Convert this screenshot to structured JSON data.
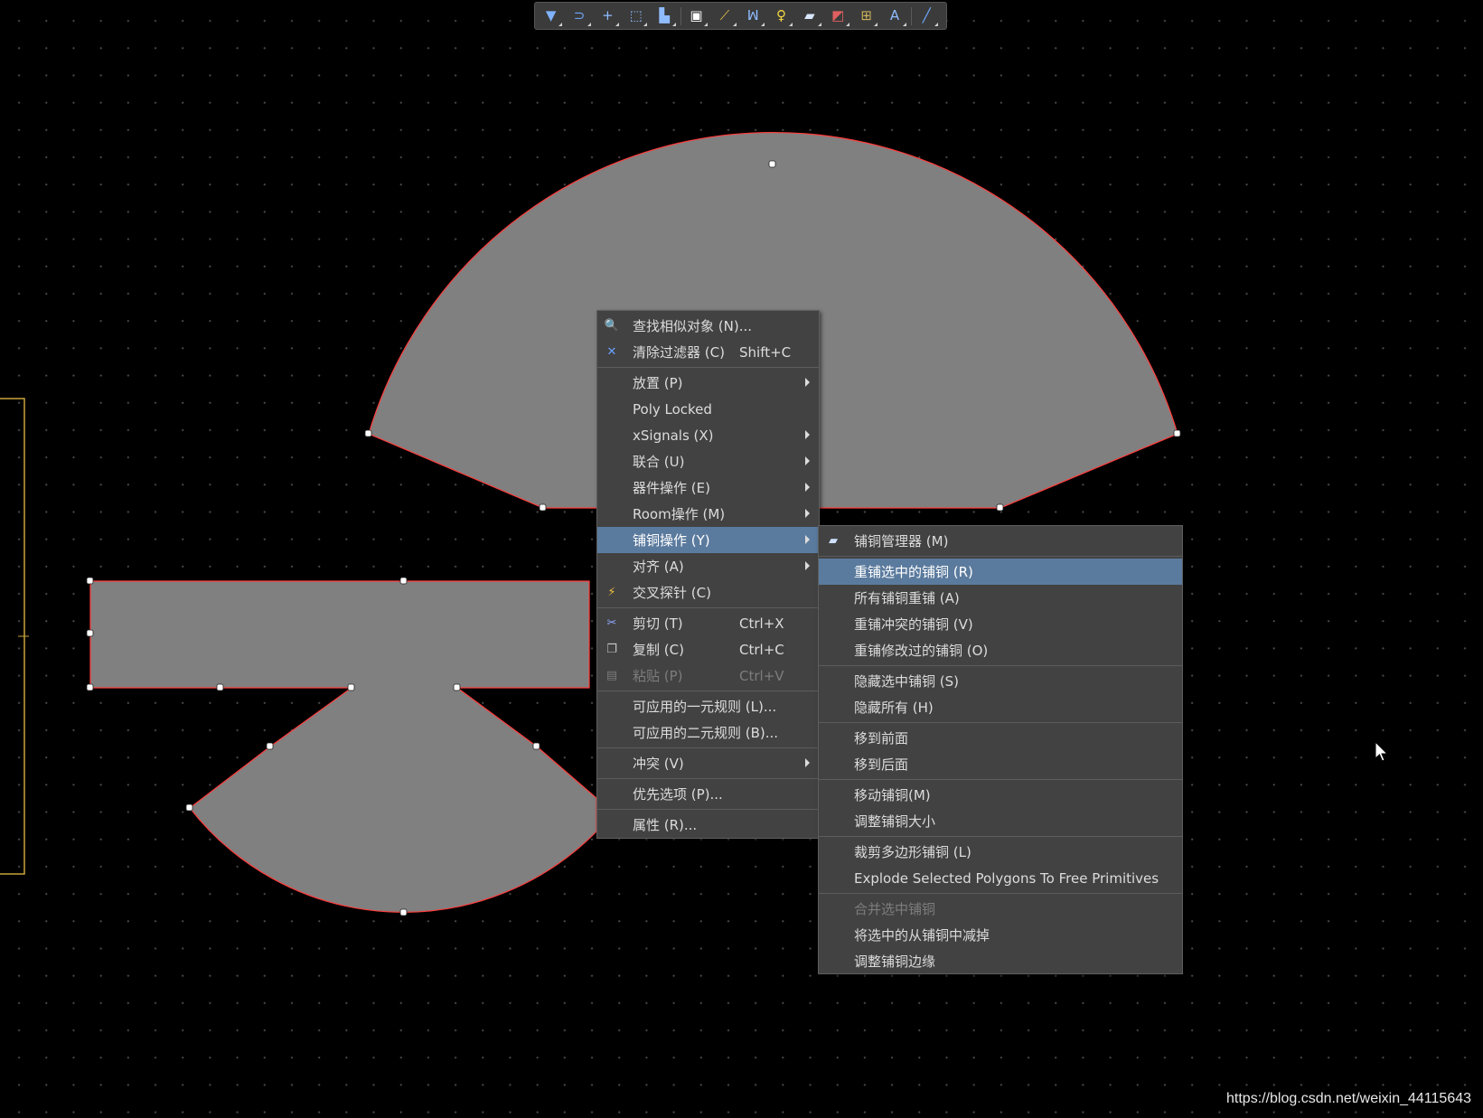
{
  "toolbar": {
    "tools": [
      {
        "name": "filter-icon",
        "glyph": "▼",
        "color": "#7fb2ff"
      },
      {
        "name": "route-icon",
        "glyph": "⊃",
        "color": "#6fa8ff"
      },
      {
        "name": "crosshair-icon",
        "glyph": "+",
        "color": "#8fbcff"
      },
      {
        "name": "select-rect-icon",
        "glyph": "⬚",
        "color": "#8fbcff"
      },
      {
        "name": "align-icon",
        "glyph": "▙",
        "color": "#8fbcff"
      },
      {
        "name": "component-icon",
        "glyph": "▣",
        "color": "#ffffff"
      },
      {
        "name": "interactive-route-icon",
        "glyph": "⟋",
        "color": "#e8c04a"
      },
      {
        "name": "diff-pair-icon",
        "glyph": "ꟽ",
        "color": "#8fbcff"
      },
      {
        "name": "via-icon",
        "glyph": "♀",
        "color": "#f5d742"
      },
      {
        "name": "polygon-icon",
        "glyph": "▰",
        "color": "#d8e6ff"
      },
      {
        "name": "keepout-icon",
        "glyph": "◩",
        "color": "#e06060"
      },
      {
        "name": "dimension-icon",
        "glyph": "⊞",
        "color": "#cbb25a"
      },
      {
        "name": "text-icon",
        "glyph": "A",
        "color": "#8fbcff"
      },
      {
        "name": "line-icon",
        "glyph": "╱",
        "color": "#6fa8ff"
      }
    ]
  },
  "main_menu": {
    "items": [
      {
        "type": "item",
        "label": "查找相似对象 (N)...",
        "icon": "find-similar-icon",
        "glyph": "🔍",
        "icon_color": "#e0e0e0"
      },
      {
        "type": "item",
        "label": "清除过滤器 (C)",
        "shortcut": "Shift+C",
        "icon": "clear-filter-icon",
        "glyph": "✕",
        "icon_color": "#6aa0ff"
      },
      {
        "type": "sep"
      },
      {
        "type": "item",
        "label": "放置 (P)",
        "submenu": true
      },
      {
        "type": "item",
        "label": "Poly Locked"
      },
      {
        "type": "item",
        "label": "xSignals (X)",
        "submenu": true
      },
      {
        "type": "item",
        "label": "联合 (U)",
        "submenu": true
      },
      {
        "type": "item",
        "label": "器件操作 (E)",
        "submenu": true
      },
      {
        "type": "item",
        "label": "Room操作 (M)",
        "submenu": true
      },
      {
        "type": "item",
        "label": "铺铜操作 (Y)",
        "submenu": true,
        "highlighted": true
      },
      {
        "type": "item",
        "label": "对齐 (A)",
        "submenu": true
      },
      {
        "type": "item",
        "label": "交叉探针 (C)",
        "icon": "cross-probe-icon",
        "glyph": "⚡",
        "icon_color": "#f0c040"
      },
      {
        "type": "sep"
      },
      {
        "type": "item",
        "label": "剪切 (T)",
        "shortcut": "Ctrl+X",
        "icon": "cut-icon",
        "glyph": "✂",
        "icon_color": "#8fa8ff"
      },
      {
        "type": "item",
        "label": "复制 (C)",
        "shortcut": "Ctrl+C",
        "icon": "copy-icon",
        "glyph": "❐",
        "icon_color": "#c8c8c8"
      },
      {
        "type": "item",
        "label": "粘贴 (P)",
        "shortcut": "Ctrl+V",
        "icon": "paste-icon",
        "glyph": "▤",
        "icon_color": "#7a7a7a",
        "disabled": true
      },
      {
        "type": "sep"
      },
      {
        "type": "item",
        "label": "可应用的一元规则 (L)..."
      },
      {
        "type": "item",
        "label": "可应用的二元规则 (B)..."
      },
      {
        "type": "sep"
      },
      {
        "type": "item",
        "label": "冲突 (V)",
        "submenu": true
      },
      {
        "type": "sep"
      },
      {
        "type": "item",
        "label": "优先选项 (P)..."
      },
      {
        "type": "sep"
      },
      {
        "type": "item",
        "label": "属性 (R)..."
      }
    ]
  },
  "sub_menu": {
    "items": [
      {
        "type": "item",
        "label": "铺铜管理器 (M)",
        "icon": "polygon-manager-icon",
        "glyph": "▰",
        "icon_color": "#cfe0ff"
      },
      {
        "type": "sep"
      },
      {
        "type": "item",
        "label": "重铺选中的铺铜 (R)",
        "highlighted": true
      },
      {
        "type": "item",
        "label": "所有铺铜重铺 (A)"
      },
      {
        "type": "item",
        "label": "重铺冲突的铺铜 (V)"
      },
      {
        "type": "item",
        "label": "重铺修改过的铺铜 (O)"
      },
      {
        "type": "sep"
      },
      {
        "type": "item",
        "label": "隐藏选中铺铜 (S)"
      },
      {
        "type": "item",
        "label": "隐藏所有 (H)"
      },
      {
        "type": "sep"
      },
      {
        "type": "item",
        "label": "移到前面"
      },
      {
        "type": "item",
        "label": "移到后面"
      },
      {
        "type": "sep"
      },
      {
        "type": "item",
        "label": "移动铺铜(M)"
      },
      {
        "type": "item",
        "label": "调整铺铜大小"
      },
      {
        "type": "sep"
      },
      {
        "type": "item",
        "label": "裁剪多边形铺铜 (L)"
      },
      {
        "type": "item",
        "label": "Explode Selected Polygons To Free Primitives"
      },
      {
        "type": "sep"
      },
      {
        "type": "item",
        "label": "合并选中铺铜",
        "disabled": true
      },
      {
        "type": "item",
        "label": "将选中的从铺铜中减掉"
      },
      {
        "type": "item",
        "label": "调整铺铜边缘"
      }
    ]
  },
  "watermark": "https://blog.csdn.net/weixin_44115643",
  "colors": {
    "polygon_fill": "#808080",
    "polygon_outline": "#ff3c3c",
    "menu_bg": "#424242",
    "menu_highlight": "#5b7b9e",
    "board_outline": "#c7a43c"
  }
}
